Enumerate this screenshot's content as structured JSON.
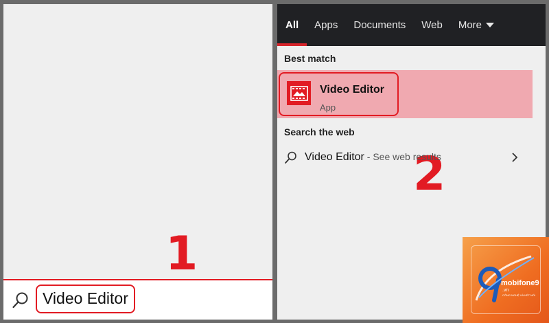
{
  "taskbar_search": {
    "query": "Video Editor",
    "icon": "search-icon"
  },
  "steps": {
    "first": "1",
    "second": "2"
  },
  "search_panel": {
    "tabs": [
      {
        "label": "All",
        "active": true
      },
      {
        "label": "Apps",
        "active": false
      },
      {
        "label": "Documents",
        "active": false
      },
      {
        "label": "Web",
        "active": false
      },
      {
        "label": "More",
        "active": false
      }
    ],
    "best_match": {
      "heading": "Best match",
      "app_name": "Video Editor",
      "app_type": "App",
      "icon": "video-editor-app-icon"
    },
    "web": {
      "heading": "Search the web",
      "query": "Video Editor",
      "suffix": " - See web results",
      "icon": "search-icon",
      "chevron": "chevron-right-icon"
    }
  },
  "watermark": {
    "brand": "mobifone9",
    "domain": ".vn",
    "tagline": "CÔNG NGHỆ VÀ KẾT NỐI"
  },
  "colors": {
    "accent_red": "#e21b23",
    "highlight": "#f0a9b0",
    "tabbar_bg": "#202124",
    "panel_bg": "#efefef",
    "frame_bg": "#6b6b6b",
    "watermark_orange": "#ef6d21"
  }
}
